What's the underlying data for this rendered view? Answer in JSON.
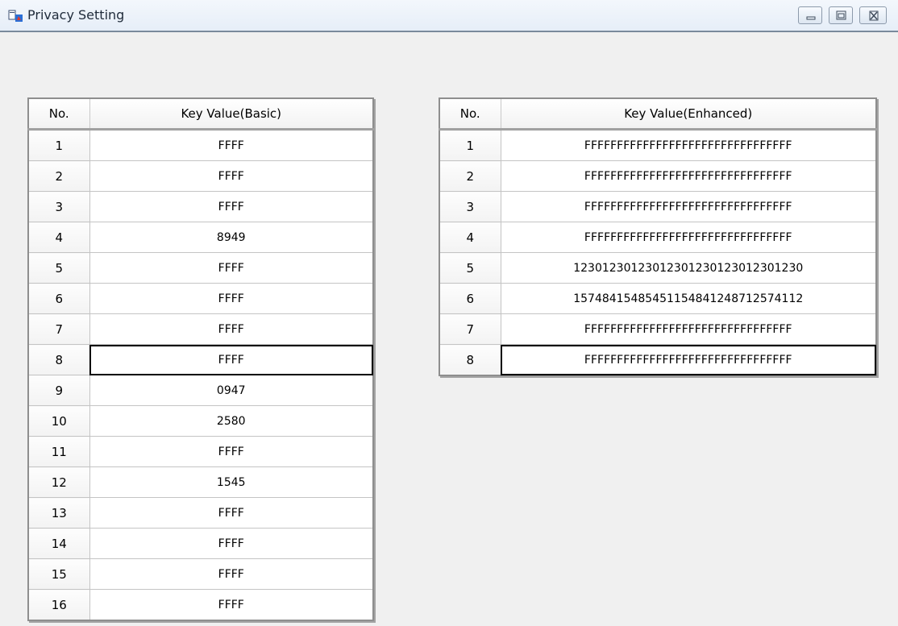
{
  "window": {
    "title": "Privacy Setting",
    "icon": "app-icon",
    "controls": [
      "minimize-icon",
      "maximize-icon",
      "close-icon"
    ]
  },
  "basic_table": {
    "headers": {
      "no": "No.",
      "value": "Key Value(Basic)"
    },
    "selected_row": 8,
    "rows": [
      {
        "no": "1",
        "value": "FFFF"
      },
      {
        "no": "2",
        "value": "FFFF"
      },
      {
        "no": "3",
        "value": "FFFF"
      },
      {
        "no": "4",
        "value": "8949"
      },
      {
        "no": "5",
        "value": "FFFF"
      },
      {
        "no": "6",
        "value": "FFFF"
      },
      {
        "no": "7",
        "value": "FFFF"
      },
      {
        "no": "8",
        "value": "FFFF"
      },
      {
        "no": "9",
        "value": "0947"
      },
      {
        "no": "10",
        "value": "2580"
      },
      {
        "no": "11",
        "value": "FFFF"
      },
      {
        "no": "12",
        "value": "1545"
      },
      {
        "no": "13",
        "value": "FFFF"
      },
      {
        "no": "14",
        "value": "FFFF"
      },
      {
        "no": "15",
        "value": "FFFF"
      },
      {
        "no": "16",
        "value": "FFFF"
      }
    ]
  },
  "enhanced_table": {
    "headers": {
      "no": "No.",
      "value": "Key Value(Enhanced)"
    },
    "selected_row": 8,
    "rows": [
      {
        "no": "1",
        "value": "FFFFFFFFFFFFFFFFFFFFFFFFFFFFFFFF"
      },
      {
        "no": "2",
        "value": "FFFFFFFFFFFFFFFFFFFFFFFFFFFFFFFF"
      },
      {
        "no": "3",
        "value": "FFFFFFFFFFFFFFFFFFFFFFFFFFFFFFFF"
      },
      {
        "no": "4",
        "value": "FFFFFFFFFFFFFFFFFFFFFFFFFFFFFFFF"
      },
      {
        "no": "5",
        "value": "12301230123012301230123012301230"
      },
      {
        "no": "6",
        "value": "15748415485451154841248712574112"
      },
      {
        "no": "7",
        "value": "FFFFFFFFFFFFFFFFFFFFFFFFFFFFFFFF"
      },
      {
        "no": "8",
        "value": "FFFFFFFFFFFFFFFFFFFFFFFFFFFFFFFF"
      }
    ]
  },
  "colors": {
    "background": "#f0f0f0",
    "titlebar": "#e6eef8",
    "grid_border": "#8e8e8e",
    "cell_line": "#c4c4c4",
    "selection": "#000000"
  }
}
